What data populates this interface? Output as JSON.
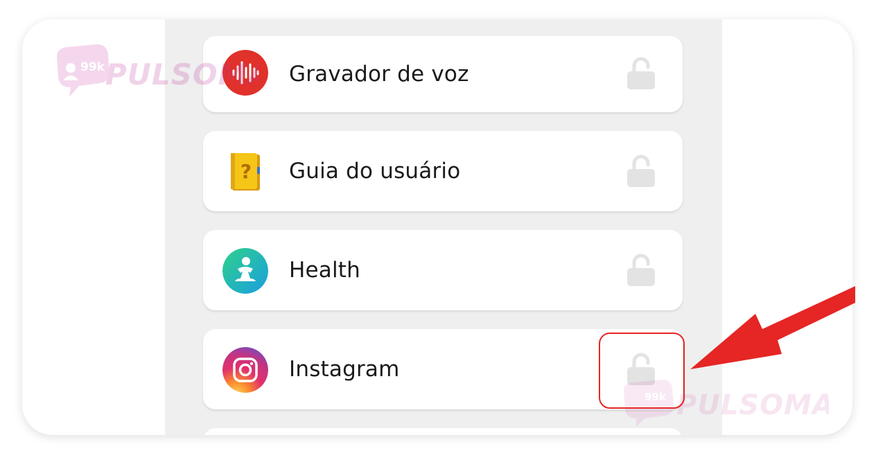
{
  "apps": [
    {
      "label": "Gravador de voz",
      "icon": "voice-recorder-icon",
      "lock": "unlocked-padlock-icon"
    },
    {
      "label": "Guia do usuário",
      "icon": "user-guide-book-icon",
      "lock": "unlocked-padlock-icon"
    },
    {
      "label": "Health",
      "icon": "samsung-health-icon",
      "lock": "unlocked-padlock-icon"
    },
    {
      "label": "Instagram",
      "icon": "instagram-icon",
      "lock": "unlocked-padlock-icon"
    }
  ],
  "watermark": {
    "badge": "99k",
    "brand": "PULSOMAX"
  },
  "colors": {
    "recorder_red": "#e0312a",
    "guide_yellow": "#f5c518",
    "health_teal": "#1bb8b2",
    "highlight_red": "#e62525",
    "lock_gray": "#e3e3e3",
    "background_gray": "#efefef"
  }
}
